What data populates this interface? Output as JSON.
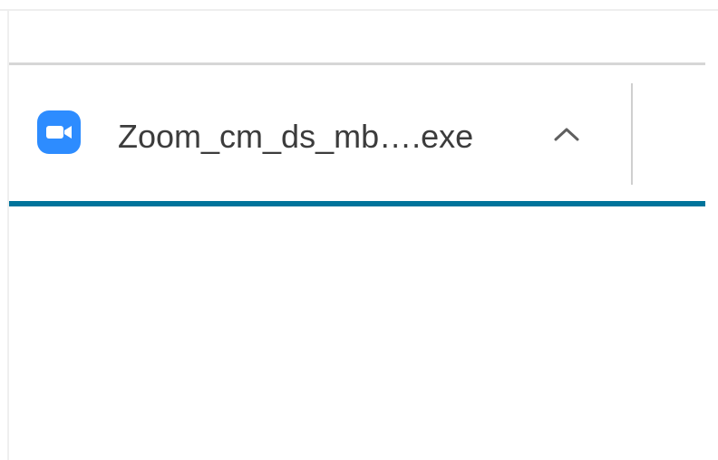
{
  "download_shelf": {
    "item": {
      "filename": "Zoom_cm_ds_mb….exe",
      "icon": "zoom-video-camera-icon",
      "menu_icon": "chevron-up-icon"
    }
  },
  "colors": {
    "zoom_blue": "#2d8cff",
    "progress_line": "#00749b",
    "text": "#3c3c3c"
  }
}
